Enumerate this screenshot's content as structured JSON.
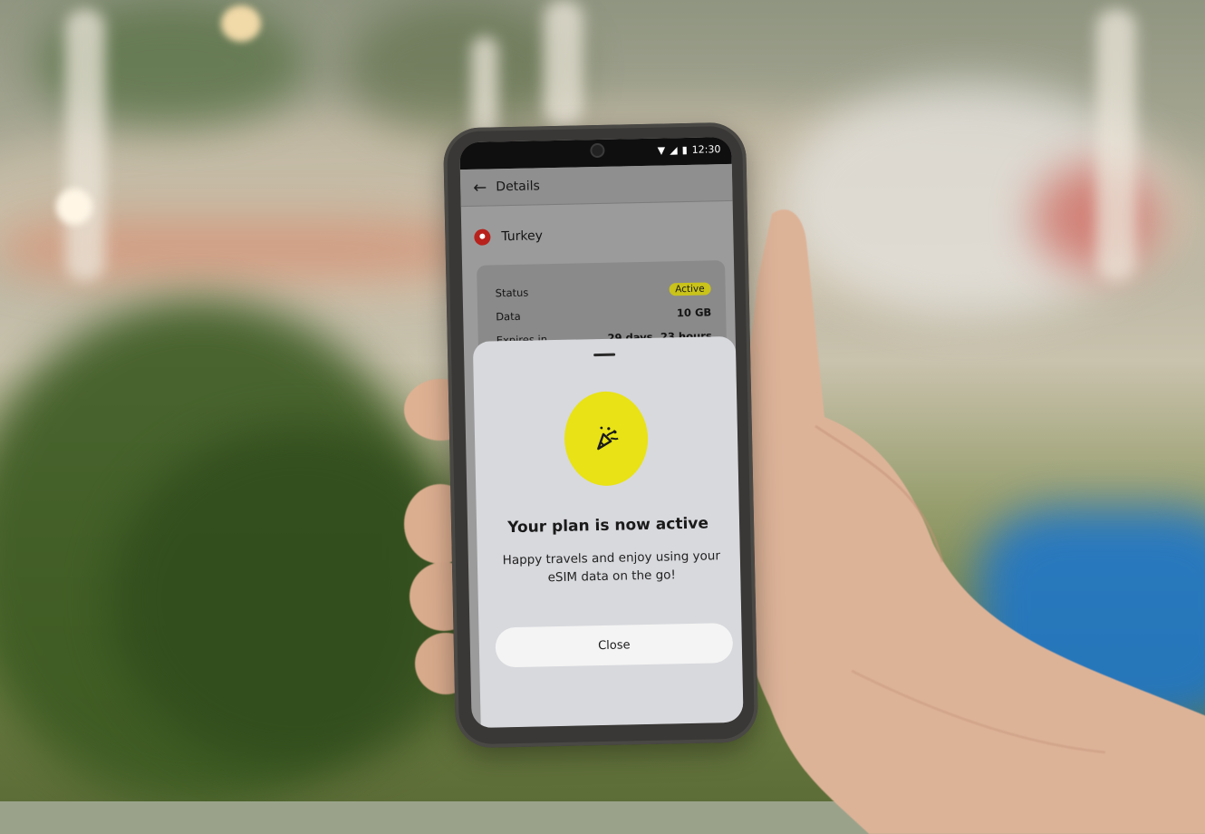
{
  "status_bar": {
    "time": "12:30"
  },
  "header": {
    "back_icon": "arrow-left-icon",
    "title": "Details"
  },
  "country": {
    "name": "Turkey",
    "flag_icon": "turkey-flag-icon"
  },
  "plan_details": {
    "status_label": "Status",
    "status_value": "Active",
    "data_label": "Data",
    "data_value": "10 GB",
    "expires_label": "Expires in",
    "expires_value": "29 days, 23 hours"
  },
  "sheet": {
    "icon": "party-popper-icon",
    "title": "Your plan is now active",
    "body": "Happy travels and enjoy using your eSIM data on the go!",
    "close_label": "Close"
  },
  "colors": {
    "accent": "#e8e216",
    "badge": "#c9c31a"
  }
}
